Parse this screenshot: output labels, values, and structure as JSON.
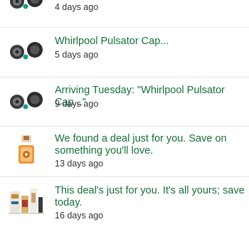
{
  "notifications": [
    {
      "title": "",
      "time": "4 days ago",
      "thumbnail": "pulsator-caps-thumbnail"
    },
    {
      "title": "Whirlpool Pulsator Cap...",
      "time": "5 days ago",
      "thumbnail": "pulsator-caps-thumbnail"
    },
    {
      "title": "Arriving Tuesday: \"Whirlpool Pulsator Cap...\"",
      "time": "9 days ago",
      "thumbnail": "pulsator-caps-thumbnail"
    },
    {
      "title": "We found a deal just for you. Save on something you'll love.",
      "time": "13 days ago",
      "thumbnail": "deal-product-thumbnail"
    },
    {
      "title": "This deal's just for you. It's all yours; save today.",
      "time": "16 days ago",
      "thumbnail": "deal-products-group-thumbnail"
    }
  ],
  "colors": {
    "title_text": "#14703a",
    "meta_text": "#333333",
    "divider": "#e6e6e6"
  }
}
